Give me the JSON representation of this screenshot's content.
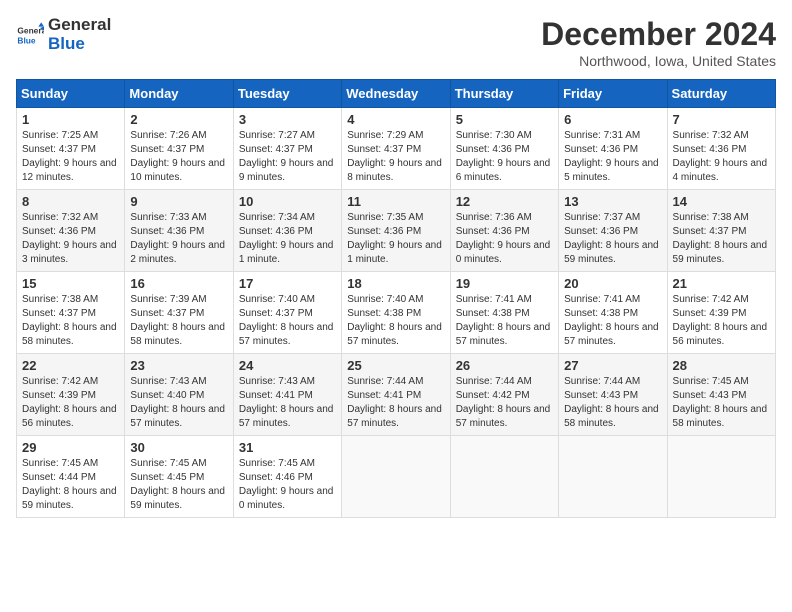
{
  "header": {
    "logo_general": "General",
    "logo_blue": "Blue",
    "title": "December 2024",
    "subtitle": "Northwood, Iowa, United States"
  },
  "days_of_week": [
    "Sunday",
    "Monday",
    "Tuesday",
    "Wednesday",
    "Thursday",
    "Friday",
    "Saturday"
  ],
  "weeks": [
    [
      {
        "day": "1",
        "sunrise": "7:25 AM",
        "sunset": "4:37 PM",
        "daylight": "9 hours and 12 minutes."
      },
      {
        "day": "2",
        "sunrise": "7:26 AM",
        "sunset": "4:37 PM",
        "daylight": "9 hours and 10 minutes."
      },
      {
        "day": "3",
        "sunrise": "7:27 AM",
        "sunset": "4:37 PM",
        "daylight": "9 hours and 9 minutes."
      },
      {
        "day": "4",
        "sunrise": "7:29 AM",
        "sunset": "4:37 PM",
        "daylight": "9 hours and 8 minutes."
      },
      {
        "day": "5",
        "sunrise": "7:30 AM",
        "sunset": "4:36 PM",
        "daylight": "9 hours and 6 minutes."
      },
      {
        "day": "6",
        "sunrise": "7:31 AM",
        "sunset": "4:36 PM",
        "daylight": "9 hours and 5 minutes."
      },
      {
        "day": "7",
        "sunrise": "7:32 AM",
        "sunset": "4:36 PM",
        "daylight": "9 hours and 4 minutes."
      }
    ],
    [
      {
        "day": "8",
        "sunrise": "7:32 AM",
        "sunset": "4:36 PM",
        "daylight": "9 hours and 3 minutes."
      },
      {
        "day": "9",
        "sunrise": "7:33 AM",
        "sunset": "4:36 PM",
        "daylight": "9 hours and 2 minutes."
      },
      {
        "day": "10",
        "sunrise": "7:34 AM",
        "sunset": "4:36 PM",
        "daylight": "9 hours and 1 minute."
      },
      {
        "day": "11",
        "sunrise": "7:35 AM",
        "sunset": "4:36 PM",
        "daylight": "9 hours and 1 minute."
      },
      {
        "day": "12",
        "sunrise": "7:36 AM",
        "sunset": "4:36 PM",
        "daylight": "9 hours and 0 minutes."
      },
      {
        "day": "13",
        "sunrise": "7:37 AM",
        "sunset": "4:36 PM",
        "daylight": "8 hours and 59 minutes."
      },
      {
        "day": "14",
        "sunrise": "7:38 AM",
        "sunset": "4:37 PM",
        "daylight": "8 hours and 59 minutes."
      }
    ],
    [
      {
        "day": "15",
        "sunrise": "7:38 AM",
        "sunset": "4:37 PM",
        "daylight": "8 hours and 58 minutes."
      },
      {
        "day": "16",
        "sunrise": "7:39 AM",
        "sunset": "4:37 PM",
        "daylight": "8 hours and 58 minutes."
      },
      {
        "day": "17",
        "sunrise": "7:40 AM",
        "sunset": "4:37 PM",
        "daylight": "8 hours and 57 minutes."
      },
      {
        "day": "18",
        "sunrise": "7:40 AM",
        "sunset": "4:38 PM",
        "daylight": "8 hours and 57 minutes."
      },
      {
        "day": "19",
        "sunrise": "7:41 AM",
        "sunset": "4:38 PM",
        "daylight": "8 hours and 57 minutes."
      },
      {
        "day": "20",
        "sunrise": "7:41 AM",
        "sunset": "4:38 PM",
        "daylight": "8 hours and 57 minutes."
      },
      {
        "day": "21",
        "sunrise": "7:42 AM",
        "sunset": "4:39 PM",
        "daylight": "8 hours and 56 minutes."
      }
    ],
    [
      {
        "day": "22",
        "sunrise": "7:42 AM",
        "sunset": "4:39 PM",
        "daylight": "8 hours and 56 minutes."
      },
      {
        "day": "23",
        "sunrise": "7:43 AM",
        "sunset": "4:40 PM",
        "daylight": "8 hours and 57 minutes."
      },
      {
        "day": "24",
        "sunrise": "7:43 AM",
        "sunset": "4:41 PM",
        "daylight": "8 hours and 57 minutes."
      },
      {
        "day": "25",
        "sunrise": "7:44 AM",
        "sunset": "4:41 PM",
        "daylight": "8 hours and 57 minutes."
      },
      {
        "day": "26",
        "sunrise": "7:44 AM",
        "sunset": "4:42 PM",
        "daylight": "8 hours and 57 minutes."
      },
      {
        "day": "27",
        "sunrise": "7:44 AM",
        "sunset": "4:43 PM",
        "daylight": "8 hours and 58 minutes."
      },
      {
        "day": "28",
        "sunrise": "7:45 AM",
        "sunset": "4:43 PM",
        "daylight": "8 hours and 58 minutes."
      }
    ],
    [
      {
        "day": "29",
        "sunrise": "7:45 AM",
        "sunset": "4:44 PM",
        "daylight": "8 hours and 59 minutes."
      },
      {
        "day": "30",
        "sunrise": "7:45 AM",
        "sunset": "4:45 PM",
        "daylight": "8 hours and 59 minutes."
      },
      {
        "day": "31",
        "sunrise": "7:45 AM",
        "sunset": "4:46 PM",
        "daylight": "9 hours and 0 minutes."
      },
      null,
      null,
      null,
      null
    ]
  ]
}
